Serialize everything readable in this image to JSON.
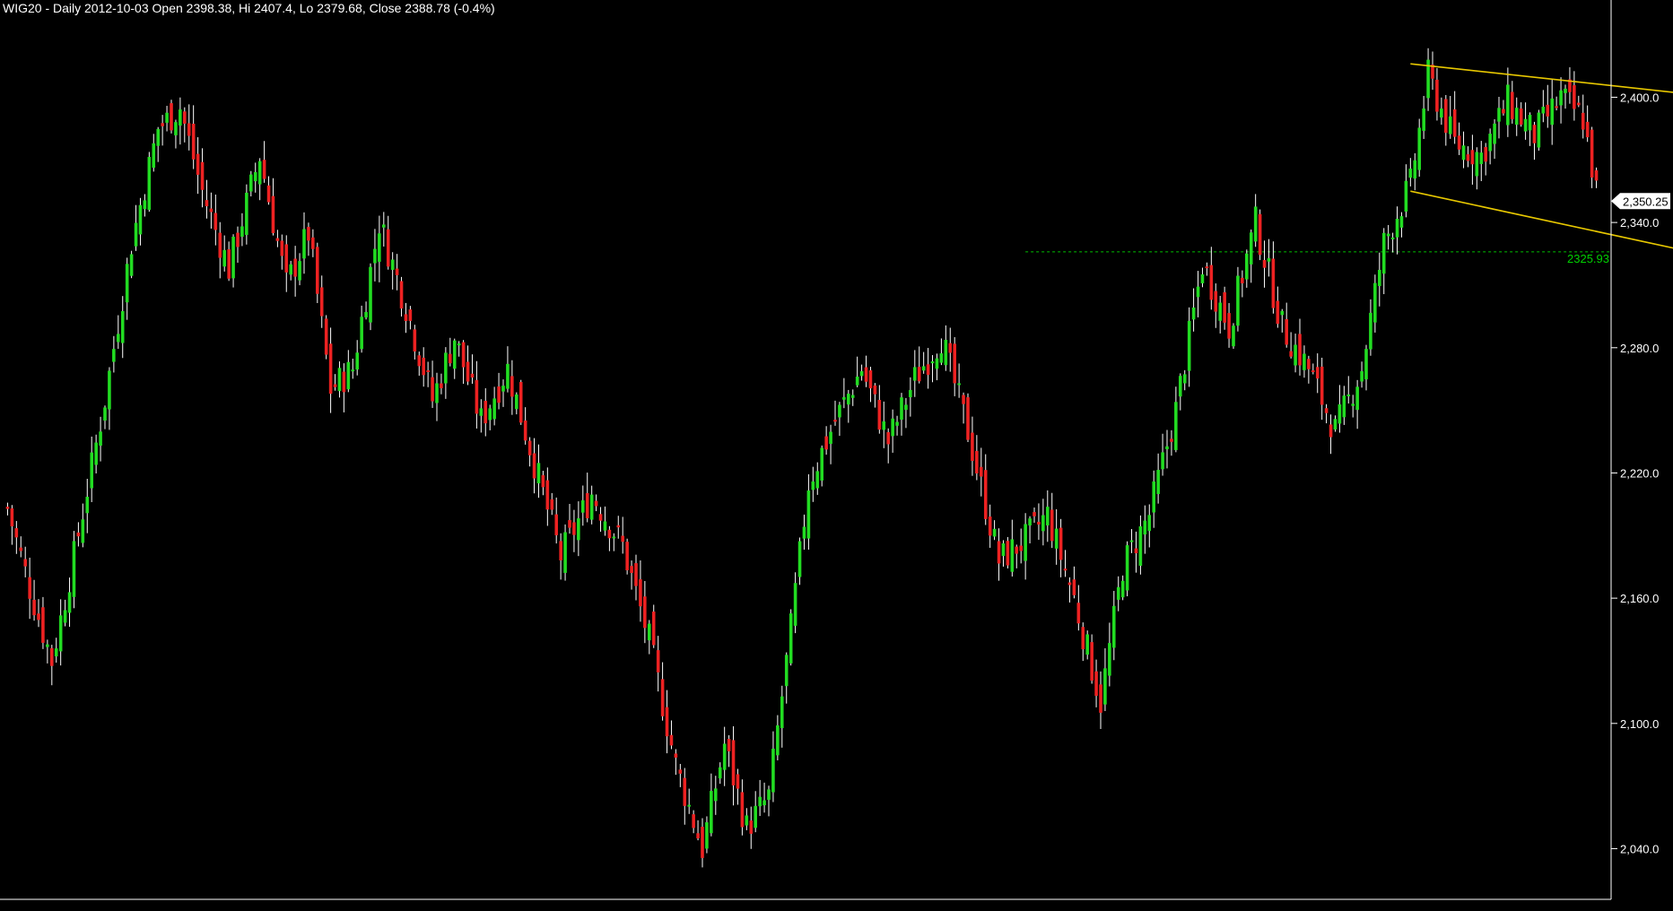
{
  "header": {
    "text": "WIG20 - Daily 2012-10-03 Open 2398.38, Hi 2407.4, Lo 2379.68, Close 2388.78 (-0.4%)"
  },
  "colors": {
    "background": "#000000",
    "up_candle": "#22dd22",
    "down_candle": "#ee2222",
    "trendline": "#e8c800",
    "level_line": "#00c000",
    "axis": "#ffffff"
  },
  "chart_data": {
    "type": "candlestick",
    "title": "WIG20",
    "ylim": [
      2017,
      2438
    ],
    "y_ticks": [
      {
        "value": 2400,
        "label": "2,400.0"
      },
      {
        "value": 2340,
        "label": "2,340.0"
      },
      {
        "value": 2280,
        "label": "2,280.0"
      },
      {
        "value": 2220,
        "label": "2,220.0"
      },
      {
        "value": 2160,
        "label": "2,160.0"
      },
      {
        "value": 2100,
        "label": "2,100.0"
      },
      {
        "value": 2040,
        "label": "2,040.0"
      }
    ],
    "last_price": {
      "value": 2350.25,
      "label": "2,350.25"
    },
    "support_level": {
      "value": 2325.93,
      "label": "2325.93"
    },
    "waypoints": [
      [
        0,
        2203
      ],
      [
        5,
        2165
      ],
      [
        10,
        2130
      ],
      [
        15,
        2180
      ],
      [
        22,
        2255
      ],
      [
        28,
        2330
      ],
      [
        34,
        2385
      ],
      [
        39,
        2395
      ],
      [
        44,
        2355
      ],
      [
        50,
        2318
      ],
      [
        57,
        2372
      ],
      [
        63,
        2310
      ],
      [
        68,
        2335
      ],
      [
        73,
        2260
      ],
      [
        78,
        2270
      ],
      [
        84,
        2340
      ],
      [
        90,
        2300
      ],
      [
        96,
        2255
      ],
      [
        101,
        2285
      ],
      [
        107,
        2245
      ],
      [
        113,
        2270
      ],
      [
        119,
        2225
      ],
      [
        125,
        2180
      ],
      [
        132,
        2210
      ],
      [
        139,
        2185
      ],
      [
        145,
        2140
      ],
      [
        151,
        2080
      ],
      [
        157,
        2040
      ],
      [
        162,
        2090
      ],
      [
        167,
        2050
      ],
      [
        172,
        2065
      ],
      [
        177,
        2145
      ],
      [
        181,
        2215
      ],
      [
        187,
        2245
      ],
      [
        193,
        2270
      ],
      [
        199,
        2235
      ],
      [
        205,
        2265
      ],
      [
        211,
        2285
      ],
      [
        217,
        2240
      ],
      [
        224,
        2178
      ],
      [
        230,
        2188
      ],
      [
        235,
        2200
      ],
      [
        241,
        2160
      ],
      [
        247,
        2110
      ],
      [
        252,
        2175
      ],
      [
        258,
        2200
      ],
      [
        264,
        2250
      ],
      [
        270,
        2320
      ],
      [
        276,
        2290
      ],
      [
        282,
        2340
      ],
      [
        288,
        2290
      ],
      [
        294,
        2270
      ],
      [
        300,
        2240
      ],
      [
        306,
        2270
      ],
      [
        311,
        2330
      ],
      [
        317,
        2358
      ],
      [
        321,
        2410
      ],
      [
        327,
        2378
      ],
      [
        333,
        2372
      ],
      [
        339,
        2398
      ],
      [
        345,
        2382
      ],
      [
        351,
        2400
      ],
      [
        356,
        2390
      ],
      [
        359,
        2355
      ]
    ],
    "trendlines": [
      {
        "x1": 317,
        "y1": 2416,
        "x2": 378,
        "y2": 2402
      },
      {
        "x1": 317,
        "y1": 2355,
        "x2": 378,
        "y2": 2327
      }
    ]
  }
}
